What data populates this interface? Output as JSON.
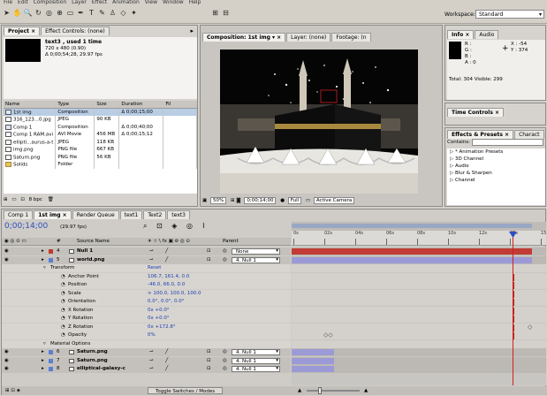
{
  "menubar": [
    "File",
    "Edit",
    "Composition",
    "Layer",
    "Effect",
    "Animation",
    "View",
    "Window",
    "Help"
  ],
  "workspace": {
    "label": "Workspace:",
    "value": "Standard"
  },
  "project_panel": {
    "tabs": [
      "Project ×",
      "Effect Controls: (none)"
    ],
    "item_name": "text3 , used 1 time",
    "item_size": "720 x 480 (0.90)",
    "item_duration": "Δ 0;00;54;28, 29.97 fps",
    "columns": [
      "Name",
      "Type",
      "Size",
      "Duration",
      "Fil"
    ],
    "rows": [
      {
        "name": "1st img",
        "type": "Composition",
        "size": "",
        "duration": "Δ 0;00;15;00",
        "icon": "comp"
      },
      {
        "name": "316_123...0.jpg",
        "type": "JPEG",
        "size": "90 KB",
        "duration": "",
        "icon": "file"
      },
      {
        "name": "Comp 1",
        "type": "Composition",
        "size": "",
        "duration": "Δ 0;00;40;00",
        "icon": "comp"
      },
      {
        "name": "Comp 1 RAM.avi",
        "type": "AVI Movie",
        "size": "456 MB",
        "duration": "Δ 0;00;15;12",
        "icon": "file"
      },
      {
        "name": "ellipti...aurus-a-t",
        "type": "JPEG",
        "size": "118 KB",
        "duration": "",
        "icon": "file"
      },
      {
        "name": "img.png",
        "type": "PNG file",
        "size": "667 KB",
        "duration": "",
        "icon": "file"
      },
      {
        "name": "Saturn.png",
        "type": "PNG file",
        "size": "56 KB",
        "duration": "",
        "icon": "file"
      },
      {
        "name": "Solids",
        "type": "Folder",
        "size": "",
        "duration": "",
        "icon": "folder"
      }
    ],
    "bpc": "8 bpc"
  },
  "comp_panel": {
    "tabs": [
      "Composition: 1st img",
      "Layer: (none)",
      "Footage: (n"
    ],
    "zoom": "50%",
    "timecode": "0;00;14;00",
    "resolution": "Full",
    "camera": "Active Camera"
  },
  "info_panel": {
    "tabs": [
      "Info ×",
      "Audio"
    ],
    "r": "R :",
    "g": "G :",
    "b": "B :",
    "a": "A : 0",
    "x": "X : -54",
    "y": "Y : 374",
    "total": "Total: 304  Visible: 299"
  },
  "time_controls": {
    "title": "Time Controls ×"
  },
  "effects_panel": {
    "tabs": [
      "Effects & Presets ×",
      "Charact"
    ],
    "contains_label": "Contains:",
    "items": [
      "▷ * Animation Presets",
      "▷ 3D Channel",
      "▷ Audio",
      "▷ Blur & Sharpen",
      "▷ Channel"
    ]
  },
  "timeline": {
    "tabs": [
      "Comp 1",
      "1st img ×",
      "Render Queue",
      "text1",
      "Text2",
      "text3"
    ],
    "current_time": "0;00;14;00",
    "fps": "(29.97 fps)",
    "columns": {
      "num": "#",
      "source": "Source Name",
      "parent": "Parent"
    },
    "ruler": [
      "0s",
      "02s",
      "04s",
      "06s",
      "08s",
      "10s",
      "12s",
      "14s",
      "15"
    ],
    "layers_top": [
      {
        "num": "4",
        "name": "Null 1",
        "parent": "None",
        "color": "#c0392b"
      },
      {
        "num": "5",
        "name": "world.png",
        "parent": "4. Null 1",
        "color": "#5b7fd1"
      }
    ],
    "props": [
      {
        "name": "Transform",
        "value": "Reset",
        "indent": 0
      },
      {
        "name": "Anchor Point",
        "value": "106.7, 161.4, 0.0",
        "indent": 1
      },
      {
        "name": "Position",
        "value": "-46.0, 66.0, 0.0",
        "indent": 1
      },
      {
        "name": "Scale",
        "value": "∞ 100.0, 100.0, 100.0",
        "indent": 1
      },
      {
        "name": "Orientation",
        "value": "0.0°, 0.0°, 0.0°",
        "indent": 1
      },
      {
        "name": "X Rotation",
        "value": "0x +0.0°",
        "indent": 1
      },
      {
        "name": "Y Rotation",
        "value": "0x +0.0°",
        "indent": 1
      },
      {
        "name": "Z Rotation",
        "value": "0x +172.8°",
        "indent": 1
      },
      {
        "name": "Opacity",
        "value": "0%",
        "indent": 1
      },
      {
        "name": "Material Options",
        "value": "",
        "indent": 0
      }
    ],
    "layers_bottom": [
      {
        "num": "6",
        "name": "Saturn.png",
        "parent": "4. Null 1",
        "color": "#5b7fd1"
      },
      {
        "num": "7",
        "name": "Saturn.png",
        "parent": "4. Null 1",
        "color": "#5b7fd1"
      },
      {
        "num": "8",
        "name": "elliptical-galaxy-c",
        "parent": "4. Null 1",
        "color": "#5b7fd1"
      }
    ],
    "toggle_label": "Toggle Switches / Modes"
  },
  "colors": {
    "accent_blue": "#2a4fc2",
    "playhead": "#d02020",
    "layer_bar": "#9c9ad6",
    "null_bar": "#c23b35"
  }
}
